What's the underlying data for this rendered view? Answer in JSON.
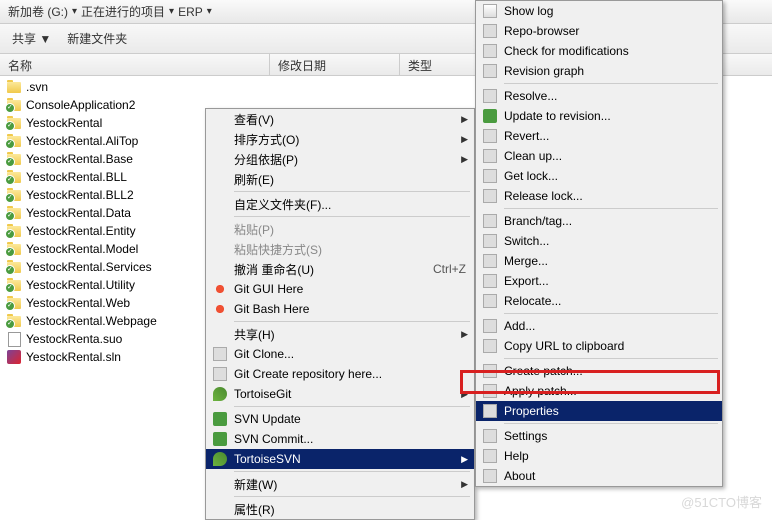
{
  "breadcrumb": {
    "p1": "新加卷 (G:)",
    "p2": "正在进行的项目",
    "p3": "ERP"
  },
  "toolbar": {
    "share": "共享 ▼",
    "newfolder": "新建文件夹"
  },
  "columns": {
    "name": "名称",
    "date": "修改日期",
    "type": "类型"
  },
  "files": {
    "f0": ".svn",
    "f1": "ConsoleApplication2",
    "f2": "YestockRental",
    "f3": "YestockRental.AliTop",
    "f4": "YestockRental.Base",
    "f5": "YestockRental.BLL",
    "f6": "YestockRental.BLL2",
    "f7": "YestockRental.Data",
    "f8": "YestockRental.Entity",
    "f9": "YestockRental.Model",
    "f10": "YestockRental.Services",
    "f11": "YestockRental.Utility",
    "f12": "YestockRental.Web",
    "f13": "YestockRental.Webpage",
    "f14": "YestockRenta.suo",
    "f15": "YestockRental.sln"
  },
  "menu1": {
    "view": "查看(V)",
    "sort": "排序方式(O)",
    "group": "分组依据(P)",
    "refresh": "刷新(E)",
    "custom": "自定义文件夹(F)...",
    "paste": "粘贴(P)",
    "pastesc": "粘贴快捷方式(S)",
    "undo": "撤消 重命名(U)",
    "undokey": "Ctrl+Z",
    "gitgui": "Git GUI Here",
    "gitbash": "Git Bash Here",
    "sharem": "共享(H)",
    "gitclone": "Git Clone...",
    "gitcreate": "Git Create repository here...",
    "tortgit": "TortoiseGit",
    "svnup": "SVN Update",
    "svncom": "SVN Commit...",
    "tortsvn": "TortoiseSVN",
    "new": "新建(W)",
    "props": "属性(R)"
  },
  "menu2": {
    "showlog": "Show log",
    "repo": "Repo-browser",
    "checkmod": "Check for modifications",
    "revgraph": "Revision graph",
    "resolve": "Resolve...",
    "update": "Update to revision...",
    "revert": "Revert...",
    "cleanup": "Clean up...",
    "getlock": "Get lock...",
    "rellock": "Release lock...",
    "branch": "Branch/tag...",
    "switch": "Switch...",
    "merge": "Merge...",
    "export": "Export...",
    "relocate": "Relocate...",
    "add": "Add...",
    "copyurl": "Copy URL to clipboard",
    "createp": "Create patch...",
    "applyp": "Apply patch...",
    "properties": "Properties",
    "settings": "Settings",
    "help": "Help",
    "about": "About"
  },
  "watermark": "@51CTO博客"
}
